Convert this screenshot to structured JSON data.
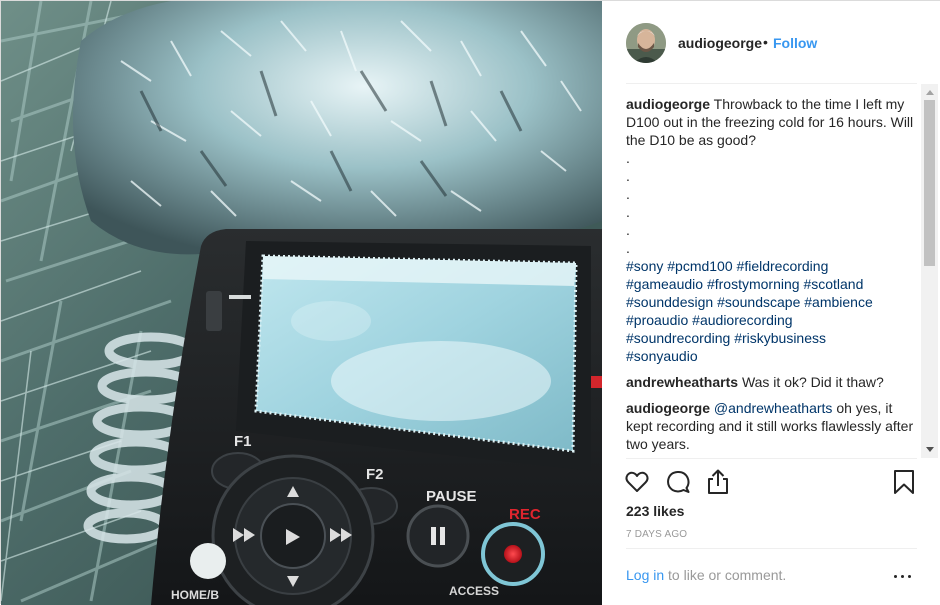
{
  "post": {
    "author": {
      "username": "audiogeorge",
      "separator": "•",
      "follow_label": "Follow"
    },
    "caption": {
      "username": "audiogeorge",
      "text": "Throwback to the time I left my D100 out in the freezing cold for 16 hours. Will the D10 be as good?",
      "dots": [
        ".",
        ".",
        ".",
        ".",
        ".",
        "."
      ],
      "hashtags": [
        "#sony",
        "#pcmd100",
        "#fieldrecording",
        "#gameaudio",
        "#frostymorning",
        "#scotland",
        "#sounddesign",
        "#soundscape",
        "#ambience",
        "#proaudio",
        "#audiorecording",
        "#soundrecording",
        "#riskybusiness",
        "#sonyaudio"
      ]
    },
    "comments": [
      {
        "username": "andrewheatharts",
        "text": "Was it ok? Did it thaw?"
      },
      {
        "username": "audiogeorge",
        "mention": "@andrewheatharts",
        "text": "oh yes, it kept recording and it still works flawlessly after two years."
      }
    ],
    "likes_text": "223 likes",
    "timestamp": "7 DAYS AGO",
    "login": {
      "link_text": "Log in",
      "rest_text": " to like or comment."
    },
    "photo": {
      "recorder_labels": {
        "f1": "F1",
        "f2": "F2",
        "pause": "PAUSE",
        "rec": "REC",
        "access": "ACCESS",
        "home": "HOME/B"
      }
    }
  },
  "icons": {
    "like": "heart-outline",
    "comment": "speech-bubble",
    "share": "share-arrow",
    "save": "bookmark",
    "more": "horizontal-ellipsis"
  },
  "colors": {
    "link_blue": "#3897f0",
    "hashtag_blue": "#003569",
    "text": "#262626",
    "muted": "#999999",
    "rec_red": "#e0252e"
  }
}
